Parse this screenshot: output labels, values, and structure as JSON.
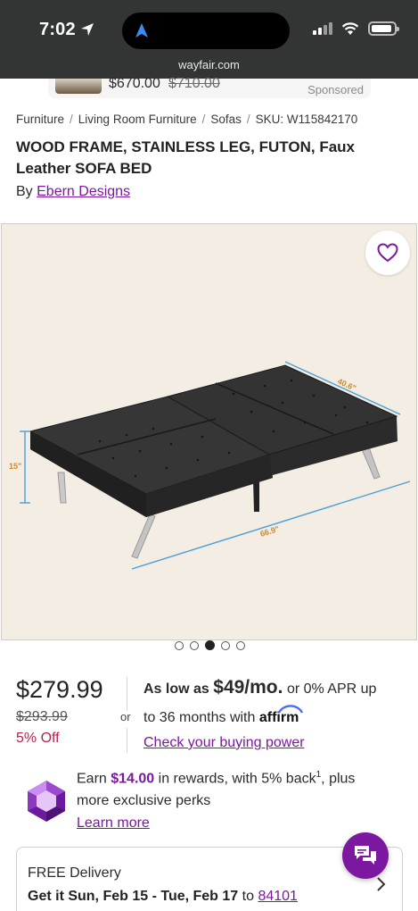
{
  "status": {
    "time": "7:02",
    "url": "wayfair.com"
  },
  "sponsored": {
    "price": "$670.00",
    "old_price": "$710.00",
    "tag": "Sponsored"
  },
  "breadcrumb": [
    "Furniture",
    "Living Room Furniture",
    "Sofas",
    "SKU: W115842170"
  ],
  "product": {
    "title": "WOOD FRAME, STAINLESS LEG, FUTON, Faux Leather SOFA BED",
    "by_label": "By",
    "brand": "Ebern Designs",
    "dimensions": {
      "height": "15\"",
      "depth": "40.6\"",
      "width": "66.9\""
    },
    "image_count": 5,
    "active_image": 3
  },
  "price": {
    "current": "$279.99",
    "old": "$293.99",
    "off": "5% Off",
    "or": "or"
  },
  "financing": {
    "as_low_as": "As low as",
    "monthly": "$49/mo.",
    "apr": "or 0% APR up",
    "line2": "to 36 months with",
    "affirm": "affirm",
    "link": "Check your buying power"
  },
  "rewards": {
    "earn": "Earn",
    "amount": "$14.00",
    "rest": "in rewards, with 5% back",
    "sup": "1",
    "rest2": ", plus",
    "line2": "more exclusive perks",
    "link": "Learn more"
  },
  "delivery": {
    "label": "FREE Delivery",
    "dates": "Get it Sun, Feb 15 - Tue, Feb 17",
    "to": "to",
    "zip": "84101"
  },
  "colors": {
    "accent": "#7b189f",
    "sale": "#b8234a",
    "dimension_line": "#4a9fd8"
  }
}
